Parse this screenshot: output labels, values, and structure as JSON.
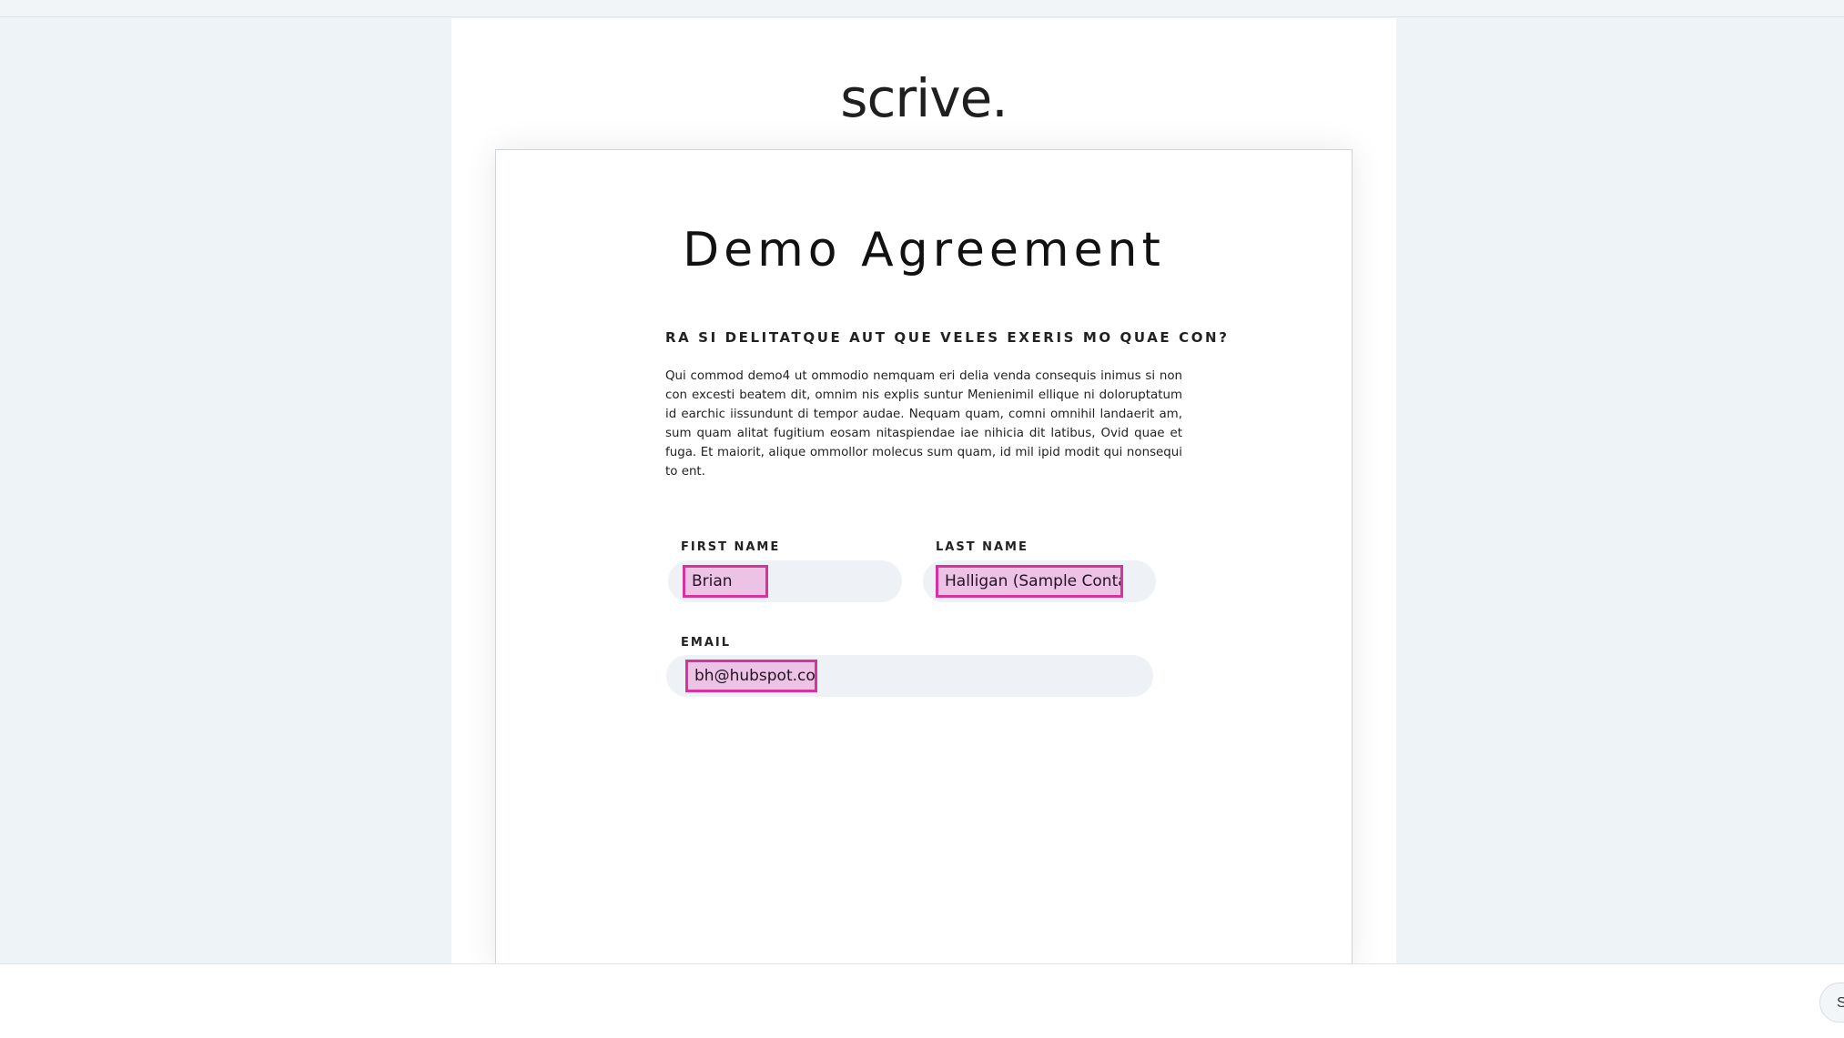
{
  "header": {
    "logo_text": "scrive."
  },
  "document": {
    "title": "Demo Agreement",
    "heading": "RA SI DELITATQUE AUT QUE VELES EXERIS MO QUAE CON?",
    "body": "Qui commod demo4 ut ommodio nemquam eri delia venda consequis inimus si non con excesti beatem dit, omnim nis explis suntur Menienimil ellique ni doloruptatum id earchic iissundunt di tempor audae. Nequam quam, comni omnihil landaerit am, sum quam alitat fugitium eosam nitaspiendae iae nihicia dit latibus, Ovid quae et fuga. Et maiorit, alique ommollor molecus sum quam, id mil ipid modit qui nonsequi to ent."
  },
  "fields": {
    "first_name": {
      "label": "FIRST NAME",
      "value": "Brian"
    },
    "last_name": {
      "label": "LAST NAME",
      "value": "Halligan (Sample Contact)"
    },
    "email": {
      "label": "EMAIL",
      "value": "bh@hubspot.com"
    }
  },
  "footer": {
    "button_label": "S"
  },
  "colors": {
    "background": "#eef3f7",
    "field_highlight": "#ecc3e4",
    "field_border": "#d7339c",
    "pill_background": "#eef1f6"
  }
}
